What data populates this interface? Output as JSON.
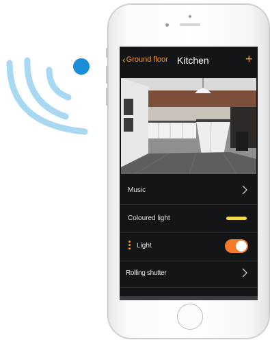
{
  "colors": {
    "accent": "#f39a2e",
    "wifi": "#a9d8f2",
    "wifi_dot": "#1a8ed8",
    "toggle_on": "#f47b2a",
    "coloured_light": "#f2d84b",
    "screen_bg": "#141517"
  },
  "nav": {
    "back_icon": "chevron-left-icon",
    "back_label": "Ground floor",
    "title": "Kitchen",
    "add_label": "+"
  },
  "photo": {
    "description_icon": "kitchen-photo"
  },
  "rows": [
    {
      "label": "Music",
      "control": "chevron-right-icon"
    },
    {
      "label": "Coloured light",
      "control": "color-bar"
    },
    {
      "label": "Light",
      "control": "toggle",
      "toggle_on": true
    },
    {
      "label": "Rolling shutter",
      "control": "chevron-right-icon"
    }
  ]
}
